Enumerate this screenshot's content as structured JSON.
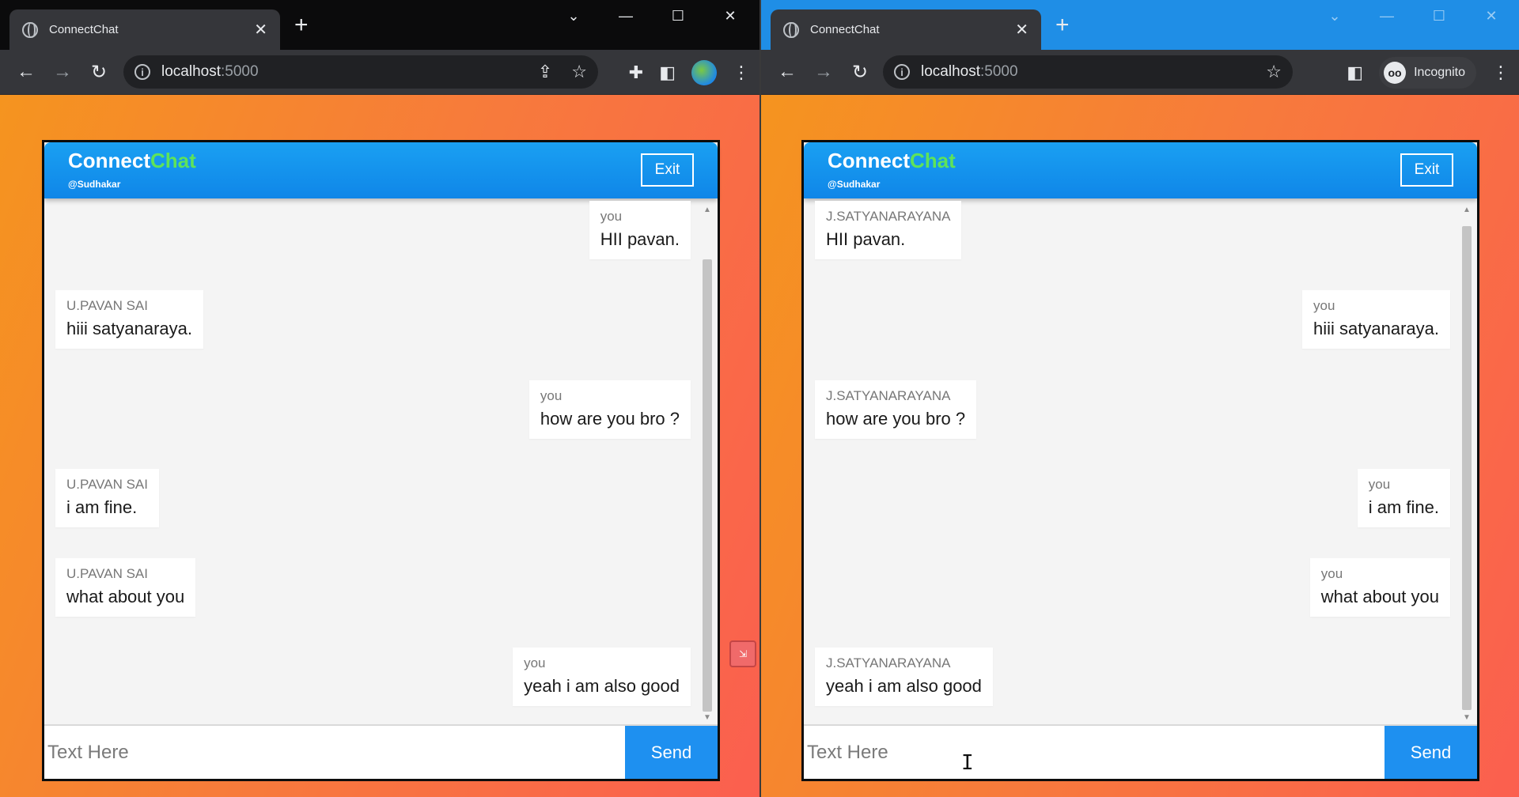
{
  "left_window": {
    "tab_title": "ConnectChat",
    "url_host": "localhost",
    "url_port": ":5000",
    "controls": {
      "collapse": "⌄",
      "minimize": "—",
      "maximize": "☐",
      "close": "✕"
    }
  },
  "right_window": {
    "tab_title": "ConnectChat",
    "url_host": "localhost",
    "url_port": ":5000",
    "incognito_label": "Incognito",
    "controls": {
      "collapse": "⌄",
      "minimize": "—",
      "maximize": "☐",
      "close": "✕"
    }
  },
  "chat_left": {
    "brand_primary": "Connect",
    "brand_accent": "Chat",
    "handle": "@Sudhakar",
    "exit_label": "Exit",
    "input_placeholder": "Text Here",
    "send_label": "Send",
    "messages": [
      {
        "sender": "you",
        "text": "HII pavan.",
        "side": "right"
      },
      {
        "sender": "U.PAVAN SAI",
        "text": "hiii satyanaraya.",
        "side": "left"
      },
      {
        "sender": "you",
        "text": "how are you bro ?",
        "side": "right"
      },
      {
        "sender": "U.PAVAN SAI",
        "text": "i am fine.",
        "side": "left"
      },
      {
        "sender": "U.PAVAN SAI",
        "text": "what about you",
        "side": "left"
      },
      {
        "sender": "you",
        "text": "yeah i am also good",
        "side": "right"
      }
    ]
  },
  "chat_right": {
    "brand_primary": "Connect",
    "brand_accent": "Chat",
    "handle": "@Sudhakar",
    "exit_label": "Exit",
    "input_placeholder": "Text Here",
    "send_label": "Send",
    "messages": [
      {
        "sender": "J.SATYANARAYANA",
        "text": "HII pavan.",
        "side": "left"
      },
      {
        "sender": "you",
        "text": "hiii satyanaraya.",
        "side": "right"
      },
      {
        "sender": "J.SATYANARAYANA",
        "text": "how are you bro ?",
        "side": "left"
      },
      {
        "sender": "you",
        "text": "i am fine.",
        "side": "right"
      },
      {
        "sender": "you",
        "text": "what about you",
        "side": "right"
      },
      {
        "sender": "J.SATYANARAYANA",
        "text": "yeah i am also good",
        "side": "left"
      }
    ]
  },
  "colors": {
    "header_blue": "#1aa0f2",
    "brand_green": "#5ee35a",
    "send_blue": "#1e90f0",
    "bg_orange": "#f5941f",
    "bg_red": "#fb5f4f"
  }
}
